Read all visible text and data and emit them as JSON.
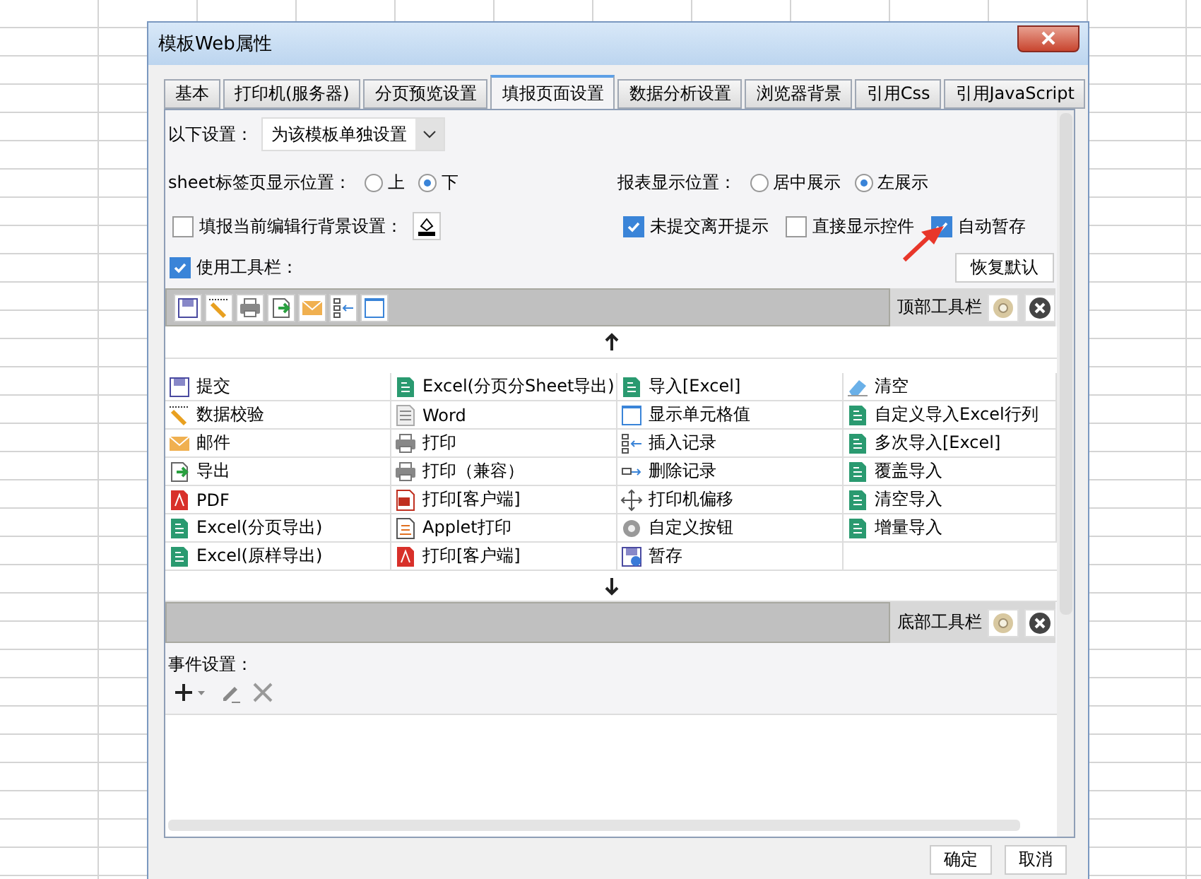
{
  "window": {
    "title": "模板Web属性"
  },
  "tabs": [
    {
      "label": "基本",
      "selected": false
    },
    {
      "label": "打印机(服务器)",
      "selected": false
    },
    {
      "label": "分页预览设置",
      "selected": false
    },
    {
      "label": "填报页面设置",
      "selected": true
    },
    {
      "label": "数据分析设置",
      "selected": false
    },
    {
      "label": "浏览器背景",
      "selected": false
    },
    {
      "label": "引用Css",
      "selected": false
    },
    {
      "label": "引用JavaScript",
      "selected": false
    }
  ],
  "settings_scope": {
    "label": "以下设置：",
    "value": "为该模板单独设置"
  },
  "sheet_tab_position": {
    "label": "sheet标签页显示位置：",
    "options": [
      {
        "label": "上",
        "selected": false
      },
      {
        "label": "下",
        "selected": true
      }
    ]
  },
  "report_position": {
    "label": "报表显示位置：",
    "options": [
      {
        "label": "居中展示",
        "selected": false
      },
      {
        "label": "左展示",
        "selected": true
      }
    ]
  },
  "row_background": {
    "label": "填报当前编辑行背景设置：",
    "checked": false
  },
  "checkboxes": [
    {
      "label": "未提交离开提示",
      "checked": true
    },
    {
      "label": "直接显示控件",
      "checked": false
    },
    {
      "label": "自动暂存",
      "checked": true
    }
  ],
  "use_toolbar": {
    "label": "使用工具栏：",
    "checked": true
  },
  "restore_button": "恢复默认",
  "top_toolbar": {
    "label": "顶部工具栏",
    "buttons": [
      {
        "kind": "save"
      },
      {
        "kind": "check"
      },
      {
        "kind": "print"
      },
      {
        "kind": "export"
      },
      {
        "kind": "mail"
      },
      {
        "kind": "insert"
      },
      {
        "kind": "cell"
      }
    ]
  },
  "toolbar_items": [
    {
      "label": "提交",
      "kind": "save"
    },
    {
      "label": "Excel(分页分Sheet导出)",
      "kind": "excel"
    },
    {
      "label": "导入[Excel]",
      "kind": "excel"
    },
    {
      "label": "清空",
      "kind": "eraser"
    },
    {
      "label": "数据校验",
      "kind": "check"
    },
    {
      "label": "Word",
      "kind": "word"
    },
    {
      "label": "显示单元格值",
      "kind": "cell"
    },
    {
      "label": "自定义导入Excel行列",
      "kind": "excel"
    },
    {
      "label": "邮件",
      "kind": "mail"
    },
    {
      "label": "打印",
      "kind": "print"
    },
    {
      "label": "插入记录",
      "kind": "insert"
    },
    {
      "label": "多次导入[Excel]",
      "kind": "excel"
    },
    {
      "label": "导出",
      "kind": "export"
    },
    {
      "label": "打印（兼容）",
      "kind": "print"
    },
    {
      "label": "删除记录",
      "kind": "delete"
    },
    {
      "label": "覆盖导入",
      "kind": "excel"
    },
    {
      "label": "PDF",
      "kind": "pdf"
    },
    {
      "label": "打印[客户端]",
      "kind": "flash"
    },
    {
      "label": "打印机偏移",
      "kind": "move"
    },
    {
      "label": "清空导入",
      "kind": "excel"
    },
    {
      "label": "Excel(分页导出)",
      "kind": "excel"
    },
    {
      "label": "Applet打印",
      "kind": "applet"
    },
    {
      "label": "自定义按钮",
      "kind": "gear"
    },
    {
      "label": "增量导入",
      "kind": "excel"
    },
    {
      "label": "Excel(原样导出)",
      "kind": "excel"
    },
    {
      "label": "打印[客户端]",
      "kind": "pdf"
    },
    {
      "label": "暂存",
      "kind": "saveclock"
    }
  ],
  "bottom_toolbar": {
    "label": "底部工具栏"
  },
  "events": {
    "label": "事件设置："
  },
  "buttons": [
    "确定",
    "取消"
  ]
}
